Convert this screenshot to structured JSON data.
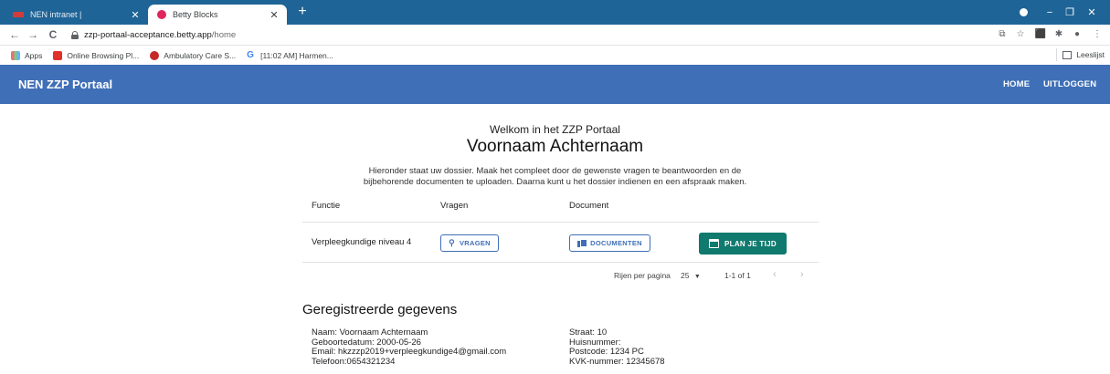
{
  "browser": {
    "tabs": [
      {
        "title": "NEN intranet |",
        "active": false
      },
      {
        "title": "Betty Blocks",
        "active": true
      }
    ],
    "new_tab": "+",
    "window_controls": {
      "minimize": "−",
      "maximize": "❐",
      "close": "✕"
    },
    "nav": {
      "back": "←",
      "forward": "→",
      "reload": "C"
    },
    "url": {
      "host": "zzp-portaal-acceptance.betty.app",
      "path": "/home"
    },
    "bookmarks": [
      {
        "label": "Apps",
        "icon": "apps-icon"
      },
      {
        "label": "Online Browsing Pl...",
        "icon": "firefox-icon"
      },
      {
        "label": "Ambulatory Care S...",
        "icon": "ambulatory-icon"
      },
      {
        "label": "[11:02 AM] Harmen...",
        "icon": "google-icon"
      }
    ],
    "reading_list": "Leeslijst"
  },
  "header": {
    "title": "NEN ZZP Portaal",
    "home": "HOME",
    "logout": "UITLOGGEN",
    "color": "#3f6fb7"
  },
  "welcome": {
    "greeting": "Welkom in het ZZP Portaal",
    "name": "Voornaam Achternaam",
    "intro_line1": "Hieronder staat uw dossier. Maak het compleet door de gewenste vragen te beantwoorden en de",
    "intro_line2": "bijbehorende documenten te uploaden. Daarna kunt u het dossier indienen en een afspraak maken."
  },
  "table": {
    "columns": [
      "Functie",
      "Vragen",
      "Document"
    ],
    "rows": [
      {
        "functie": "Verpleegkundige niveau 4",
        "vragen_button": "VRAGEN",
        "documenten_button": "DOCUMENTEN",
        "plan_button": "PLAN JE TIJD"
      }
    ],
    "pagination": {
      "rows_per_page_label": "Rijen per pagina",
      "rows_per_page_value": "25",
      "range": "1-1 of 1"
    }
  },
  "registered": {
    "title": "Geregistreerde gegevens",
    "left": [
      "Naam: Voornaam Achternaam",
      "Geboortedatum: 2000-05-26",
      "Email: hkzzzp2019+verpleegkundige4@gmail.com",
      "Telefoon:0654321234"
    ],
    "right": [
      "Straat: 10",
      "Huisnummer:",
      "Postcode: 1234 PC",
      "KVK-nummer: 12345678"
    ]
  },
  "colors": {
    "tabstrip": "#1f6496",
    "primary": "#3f6fb7",
    "accent_button": "#0f7a6d"
  }
}
